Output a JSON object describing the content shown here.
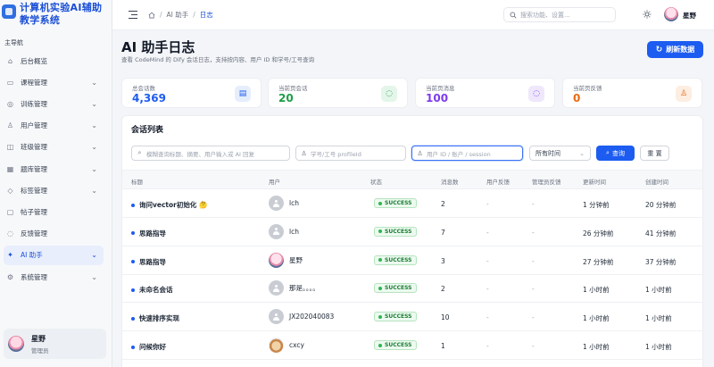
{
  "brand": {
    "title": "计算机实验AI辅助教学系统"
  },
  "sidebar": {
    "caption": "主导航",
    "items": [
      {
        "label": "后台概览",
        "icon": "home-icon",
        "chevron": false,
        "active": false
      },
      {
        "label": "课程管理",
        "icon": "book-icon",
        "chevron": true,
        "active": false
      },
      {
        "label": "训练管理",
        "icon": "target-icon",
        "chevron": true,
        "active": false
      },
      {
        "label": "用户管理",
        "icon": "users-icon",
        "chevron": true,
        "active": false
      },
      {
        "label": "班级管理",
        "icon": "class-icon",
        "chevron": true,
        "active": false
      },
      {
        "label": "题库管理",
        "icon": "question-bank-icon",
        "chevron": true,
        "active": false
      },
      {
        "label": "标签管理",
        "icon": "tag-icon",
        "chevron": true,
        "active": false
      },
      {
        "label": "帖子管理",
        "icon": "post-icon",
        "chevron": false,
        "active": false
      },
      {
        "label": "反馈管理",
        "icon": "feedback-icon",
        "chevron": false,
        "active": false
      },
      {
        "label": "AI 助手",
        "icon": "ai-icon",
        "chevron": true,
        "active": true
      },
      {
        "label": "系统管理",
        "icon": "gear-icon",
        "chevron": true,
        "active": false
      }
    ],
    "user": {
      "name": "星野",
      "role": "管理员"
    }
  },
  "topbar": {
    "breadcrumb": [
      "AI 助手",
      "日志"
    ],
    "search_placeholder": "搜索功能、设置...",
    "user_name": "星野"
  },
  "page": {
    "title": "AI 助手日志",
    "subtitle": "查看 CodeMind 的 Dify 会话日志，支持按内容、用户 ID 和学号/工号查询",
    "refresh_label": "刷新数据"
  },
  "stats": [
    {
      "label": "总会话数",
      "value": "4,369",
      "color": "#1d5cf0",
      "icon": "doc-icon",
      "icon_bg": "#e6eefc"
    },
    {
      "label": "当前页会话",
      "value": "20",
      "color": "#1b9e46",
      "icon": "chat-icon",
      "icon_bg": "#e4f6ea"
    },
    {
      "label": "当前页消息",
      "value": "100",
      "color": "#7c3aed",
      "icon": "message-icon",
      "icon_bg": "#efe7fc"
    },
    {
      "label": "当前页反馈",
      "value": "0",
      "color": "#ea6a10",
      "icon": "person-icon",
      "icon_bg": "#fdeee2"
    }
  ],
  "panel": {
    "title": "会话列表",
    "filters": {
      "keyword_placeholder": "模糊查询标题、摘要、用户输入或 AI 回复",
      "student_placeholder": "学号/工号 profileId",
      "user_placeholder": "用户 ID / 账户 / session",
      "time_select": "所有时间",
      "query_label": "查询",
      "reset_label": "重 置"
    },
    "columns": [
      "标题",
      "用户",
      "状态",
      "消息数",
      "用户反馈",
      "管理员反馈",
      "更新时间",
      "创建时间"
    ],
    "rows": [
      {
        "title": "询问vector初始化 🤔",
        "user": "lch",
        "avatar": "default",
        "status": "SUCCESS",
        "messages": "2",
        "user_feedback": "-",
        "admin_feedback": "-",
        "updated": "1 分钟前",
        "created": "20 分钟前"
      },
      {
        "title": "思路指导",
        "user": "lch",
        "avatar": "default",
        "status": "SUCCESS",
        "messages": "7",
        "user_feedback": "-",
        "admin_feedback": "-",
        "updated": "26 分钟前",
        "created": "41 分钟前"
      },
      {
        "title": "思路指导",
        "user": "星野",
        "avatar": "anime",
        "status": "SUCCESS",
        "messages": "3",
        "user_feedback": "-",
        "admin_feedback": "-",
        "updated": "27 分钟前",
        "created": "37 分钟前"
      },
      {
        "title": "未命名会话",
        "user": "那是。。。。",
        "avatar": "default",
        "status": "SUCCESS",
        "messages": "2",
        "user_feedback": "-",
        "admin_feedback": "-",
        "updated": "1 小时前",
        "created": "1 小时前"
      },
      {
        "title": "快速排序实现",
        "user": "JX202040083",
        "avatar": "default",
        "status": "SUCCESS",
        "messages": "10",
        "user_feedback": "-",
        "admin_feedback": "-",
        "updated": "1 小时前",
        "created": "1 小时前"
      },
      {
        "title": "问候你好",
        "user": "cxcy",
        "avatar": "cat",
        "status": "SUCCESS",
        "messages": "1",
        "user_feedback": "-",
        "admin_feedback": "-",
        "updated": "1 小时前",
        "created": "1 小时前"
      }
    ]
  }
}
